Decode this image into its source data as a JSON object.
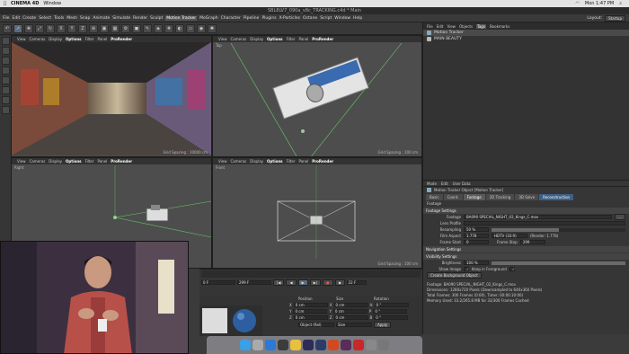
{
  "mac_menu": {
    "app": "CINEMA 4D",
    "window": "Window",
    "clock": "Mon 1:47 PM"
  },
  "window_title": "SBL8LV7_090a_v8c_TRACKING.c4d * Main",
  "menubar": [
    "File",
    "Edit",
    "Create",
    "Select",
    "Tools",
    "Mesh",
    "Snap",
    "Animate",
    "Simulate",
    "Render",
    "Sculpt",
    "Motion Tracker",
    "MoGraph",
    "Character",
    "Pipeline",
    "Plugins",
    "X-Particles",
    "Octane",
    "Script",
    "Window",
    "Help"
  ],
  "menubar_highlight": "Motion Tracker",
  "layout": {
    "label": "Layout:",
    "value": "Startup"
  },
  "viewport_menu": [
    "View",
    "Cameras",
    "Display",
    "Options",
    "Filter",
    "Panel",
    "ProRender"
  ],
  "viewports": [
    {
      "name": "",
      "grid": "Grid Spacing : 10000 cm"
    },
    {
      "name": "Top",
      "grid": "Grid Spacing : 100 cm"
    },
    {
      "name": "Right",
      "grid": ""
    },
    {
      "name": "Front",
      "grid": "Grid Spacing : 100 cm"
    }
  ],
  "object_manager": {
    "tabs": [
      "File",
      "Edit",
      "View",
      "Objects",
      "Tags",
      "Bookmarks"
    ],
    "objects": [
      "Motion Tracker",
      "MAIN BEAUTY"
    ]
  },
  "attributes": {
    "menu": [
      "Mode",
      "Edit",
      "User Data"
    ],
    "title": "Motion Tracker Object [Motion Tracker]",
    "tabs": [
      "Basic",
      "Coord.",
      "Footage",
      "2D Tracking",
      "3D Solve",
      "Reconstruction"
    ],
    "section_footage": "Footage",
    "section_footage_settings": "Footage Settings",
    "footage_label": "Footage",
    "footage_value": "BA090 SPECIAL_NIGHT_02_Kings_C.mov",
    "lens_profile": "Lens Profile",
    "resampling_label": "Resampling",
    "resampling_value": "50 %",
    "film_aspect_label": "Film Aspect",
    "film_aspect_value": "1.778",
    "film_aspect_preset": "HDTV (16:9)",
    "render_aspect": "(Render: 1.778)",
    "frame_start_label": "Frame Start",
    "frame_start_value": "0",
    "frame_stop_label": "Frame Stop",
    "frame_stop_value": "299",
    "section_nav": "Navigation Settings",
    "section_vis": "Visibility Settings",
    "brightness_label": "Brightness",
    "brightness_value": "100 %",
    "show_image_label": "Show Image",
    "keep_fg_label": "Keep in Foreground",
    "create_bg_button": "Create Background Object",
    "info": [
      "Footage: BA090 SPECIAL_NIGHT_02_Kings_C.mov",
      "Dimensions: 1280x720 Pixels (Downsampled to 640x360 Pixels)",
      "Total Frames: 300 Frames (0:00), Timer: 00:00:10:00)",
      "Memory Used: 33.2/265.8 MB for 33/300 Frames Cached"
    ]
  },
  "timeline": {
    "current_frame": "0 F",
    "end_frame": "299 F",
    "fps_field": "22 F"
  },
  "coords": {
    "headers": [
      "Position",
      "Size",
      "Rotation"
    ],
    "rows": [
      [
        "X",
        "0 cm",
        "X",
        "0 cm",
        "H",
        "0 °"
      ],
      [
        "Y",
        "0 cm",
        "Y",
        "0 cm",
        "P",
        "0 °"
      ],
      [
        "Z",
        "0 cm",
        "Z",
        "0 cm",
        "B",
        "0 °"
      ]
    ],
    "object_mode": "Object (Rel)",
    "size_mode": "Size",
    "apply": "Apply"
  }
}
